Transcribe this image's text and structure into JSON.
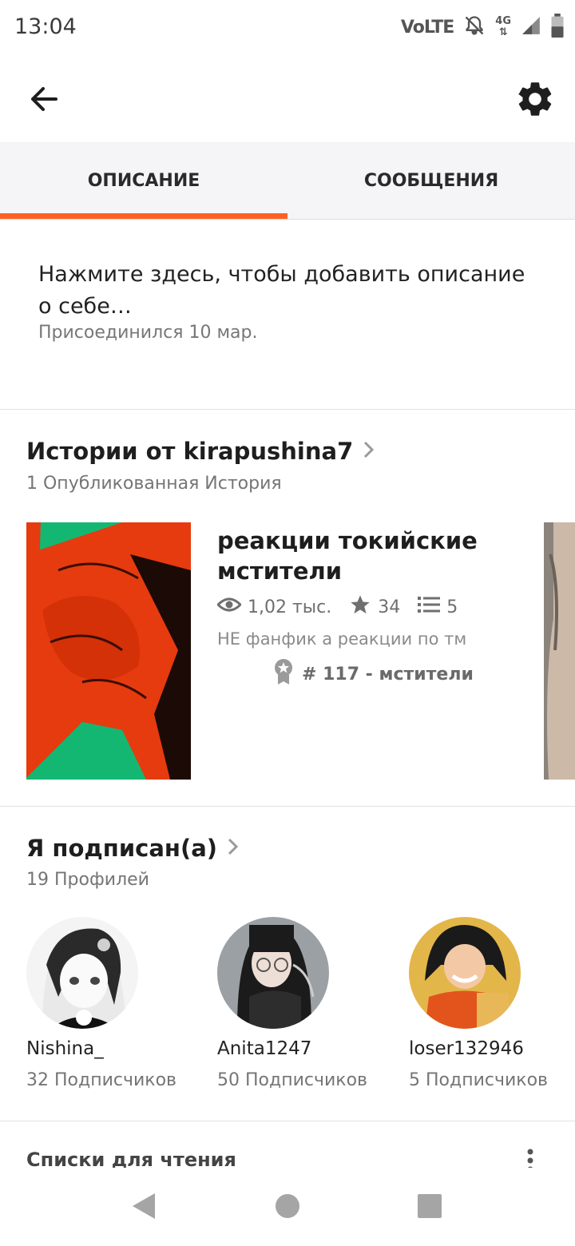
{
  "status_bar": {
    "time": "13:04",
    "volte": "VoLTE",
    "network": "4G"
  },
  "tabs": [
    {
      "label": "ОПИСАНИЕ",
      "active": true
    },
    {
      "label": "СООБЩЕНИЯ",
      "active": false
    }
  ],
  "about": {
    "description": "Нажмите здесь, чтобы добавить описание о себе…",
    "joined": "Присоединился 10 мар."
  },
  "stories_section": {
    "title": "Истории от kirapushina7",
    "subtitle": "1 Опубликованная История",
    "story": {
      "title": "реакции токийские мстители",
      "views": "1,02 тыс.",
      "votes": "34",
      "parts": "5",
      "description": "НЕ фанфик а реакции по тм",
      "rank": "# 117 - мстители"
    }
  },
  "following_section": {
    "title": "Я подписан(а)",
    "subtitle": "19 Профилей",
    "profiles": [
      {
        "name": "Nishina_",
        "followers": "32 Подписчиков"
      },
      {
        "name": "Anita1247",
        "followers": "50 Подписчиков"
      },
      {
        "name": "loser132946",
        "followers": "5 Подписчиков"
      }
    ]
  },
  "reading_lists": {
    "title": "Списки для чтения"
  },
  "colors": {
    "accent": "#ff6122",
    "tab_background": "#f5f4f6"
  }
}
